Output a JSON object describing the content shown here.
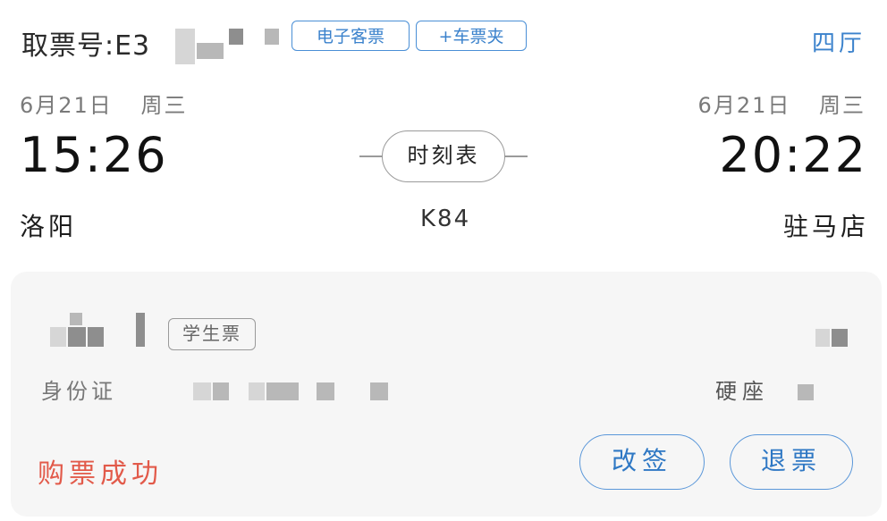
{
  "header": {
    "ticket_number_label": "取票号:E3",
    "tags": {
      "e_ticket": "电子客票",
      "add_wallet": "+车票夹"
    },
    "hall": "四厅"
  },
  "departure": {
    "date": "6月21日",
    "weekday": "周三",
    "time": "15:26",
    "station": "洛阳"
  },
  "arrival": {
    "date": "6月21日",
    "weekday": "周三",
    "time": "20:22",
    "station": "驻马店"
  },
  "train": {
    "timetable_label": "时刻表",
    "number": "K84"
  },
  "passenger": {
    "ticket_type": "学生票",
    "id_label": "身份证",
    "seat_class": "硬座"
  },
  "footer": {
    "status": "购票成功",
    "change_button": "改签",
    "refund_button": "退票"
  },
  "colors": {
    "accent_blue": "#3b82cc",
    "status_red": "#e25a4a"
  }
}
